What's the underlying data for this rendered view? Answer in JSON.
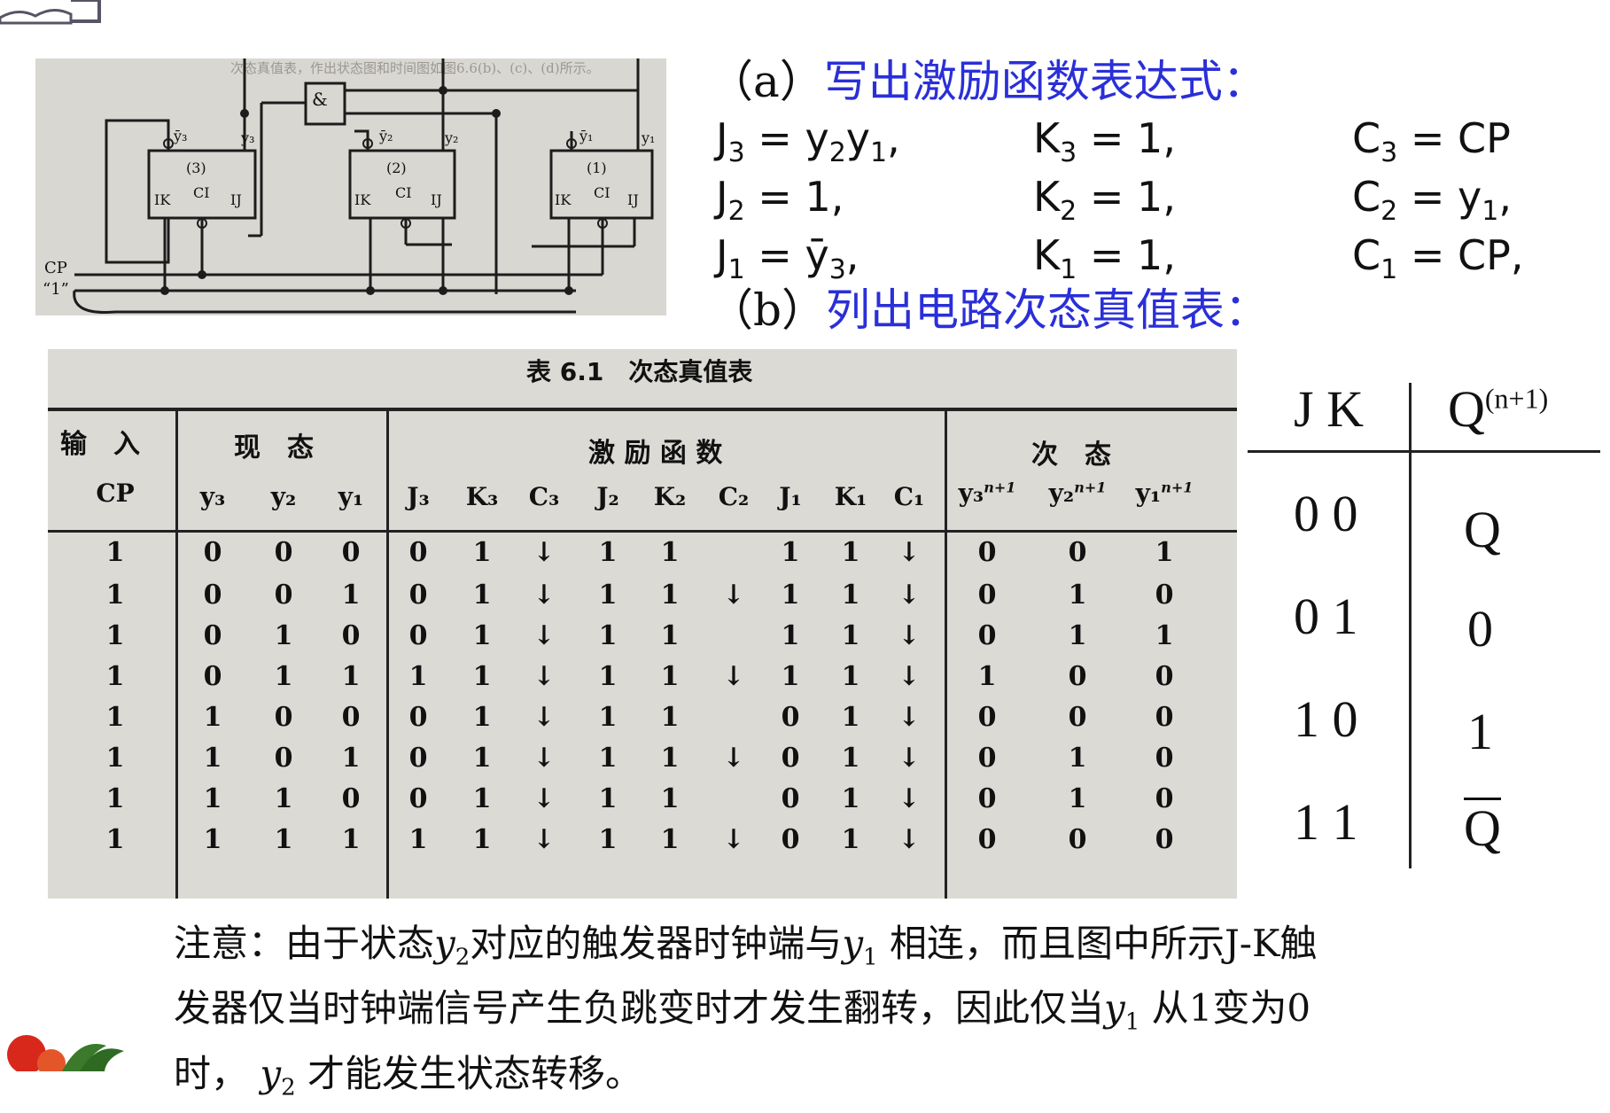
{
  "circuit": {
    "scan_text": "次态真值表，作出状态图和时间图如图6.6(b)、(c)、(d)所示。",
    "gate": "&",
    "flipflops": [
      {
        "num": "(3)",
        "qbar": "ȳ₃",
        "q": "y₃",
        "ik": "IK",
        "ci": "CI",
        "ij": "IJ"
      },
      {
        "num": "(2)",
        "qbar": "ȳ₂",
        "q": "y₂",
        "ik": "IK",
        "ci": "CI",
        "ij": "IJ"
      },
      {
        "num": "(1)",
        "qbar": "ȳ₁",
        "q": "y₁",
        "ik": "IK",
        "ci": "CI",
        "ij": "IJ"
      }
    ],
    "cp_label": "CP",
    "one_label": "“1”"
  },
  "section_a": {
    "paren": "（a）",
    "title": "写出激励函数表达式："
  },
  "equations": [
    [
      "J",
      "3",
      " = y",
      "2",
      "y",
      "1",
      ","
    ],
    [
      "K",
      "3",
      " = 1,"
    ],
    [
      "C",
      "3",
      " = CP"
    ],
    [
      "J",
      "2",
      " = 1,"
    ],
    [
      "K",
      "2",
      " = 1,"
    ],
    [
      "C",
      "2",
      " = y",
      "1",
      ","
    ],
    [
      "J",
      "1",
      " = ȳ",
      "3",
      ","
    ],
    [
      "K",
      "1",
      " = 1,"
    ],
    [
      "C",
      "1",
      " = CP,"
    ]
  ],
  "section_b": {
    "paren": "（b）",
    "title": "列出电路次态真值表："
  },
  "table": {
    "title": "表 6.1　次态真值表",
    "groups": [
      "输　入",
      "现　态",
      "激 励 函 数",
      "次　态"
    ],
    "cp": "CP",
    "present_cols": [
      "y₃",
      "y₂",
      "y₁"
    ],
    "excite_cols": [
      "J₃",
      "K₃",
      "C₃",
      "J₂",
      "K₂",
      "C₂",
      "J₁",
      "K₁",
      "C₁"
    ],
    "next_cols": [
      "y₃",
      "y₂",
      "y₁"
    ],
    "next_sup": "n+1",
    "arrow": "↓",
    "rows": [
      [
        "1",
        "0",
        "0",
        "0",
        "0",
        "1",
        "↓",
        "1",
        "1",
        "",
        "1",
        "1",
        "↓",
        "0",
        "0",
        "1"
      ],
      [
        "1",
        "0",
        "0",
        "1",
        "0",
        "1",
        "↓",
        "1",
        "1",
        "↓",
        "1",
        "1",
        "↓",
        "0",
        "1",
        "0"
      ],
      [
        "1",
        "0",
        "1",
        "0",
        "0",
        "1",
        "↓",
        "1",
        "1",
        "",
        "1",
        "1",
        "↓",
        "0",
        "1",
        "1"
      ],
      [
        "1",
        "0",
        "1",
        "1",
        "1",
        "1",
        "↓",
        "1",
        "1",
        "↓",
        "1",
        "1",
        "↓",
        "1",
        "0",
        "0"
      ],
      [
        "1",
        "1",
        "0",
        "0",
        "0",
        "1",
        "↓",
        "1",
        "1",
        "",
        "0",
        "1",
        "↓",
        "0",
        "0",
        "0"
      ],
      [
        "1",
        "1",
        "0",
        "1",
        "0",
        "1",
        "↓",
        "1",
        "1",
        "↓",
        "0",
        "1",
        "↓",
        "0",
        "1",
        "0"
      ],
      [
        "1",
        "1",
        "1",
        "0",
        "0",
        "1",
        "↓",
        "1",
        "1",
        "",
        "0",
        "1",
        "↓",
        "0",
        "1",
        "0"
      ],
      [
        "1",
        "1",
        "1",
        "1",
        "1",
        "1",
        "↓",
        "1",
        "1",
        "↓",
        "0",
        "1",
        "↓",
        "0",
        "0",
        "0"
      ]
    ]
  },
  "jk_table": {
    "header_left": "J  K",
    "header_right": "Q",
    "header_sup": "(n+1)",
    "rows": [
      {
        "jk": "0 0",
        "q": "Q"
      },
      {
        "jk": "0 1",
        "q": "0"
      },
      {
        "jk": "1 0",
        "q": "1"
      },
      {
        "jk": "1 1",
        "q": "Q"
      }
    ]
  },
  "note": {
    "l1a": "注意：由于状态",
    "l1v": "y",
    "l1s": "2",
    "l1b": "对应的触发器时钟端与",
    "l1v2": "y",
    "l1s2": "1",
    "l1c": " 相连，而且图中所示J-K触",
    "l2a": "发器仅当时钟端信号产生负跳变时才发生翻转，因此仅当",
    "l2v": "y",
    "l2s": "1",
    "l2b": " 从1变为0",
    "l3a": "时，  ",
    "l3v": "y",
    "l3s": "2",
    "l3b": " 才能发生状态转移。"
  },
  "colors": {
    "accent": "#2a2fd8",
    "photo_bg": "#dcdad5"
  }
}
